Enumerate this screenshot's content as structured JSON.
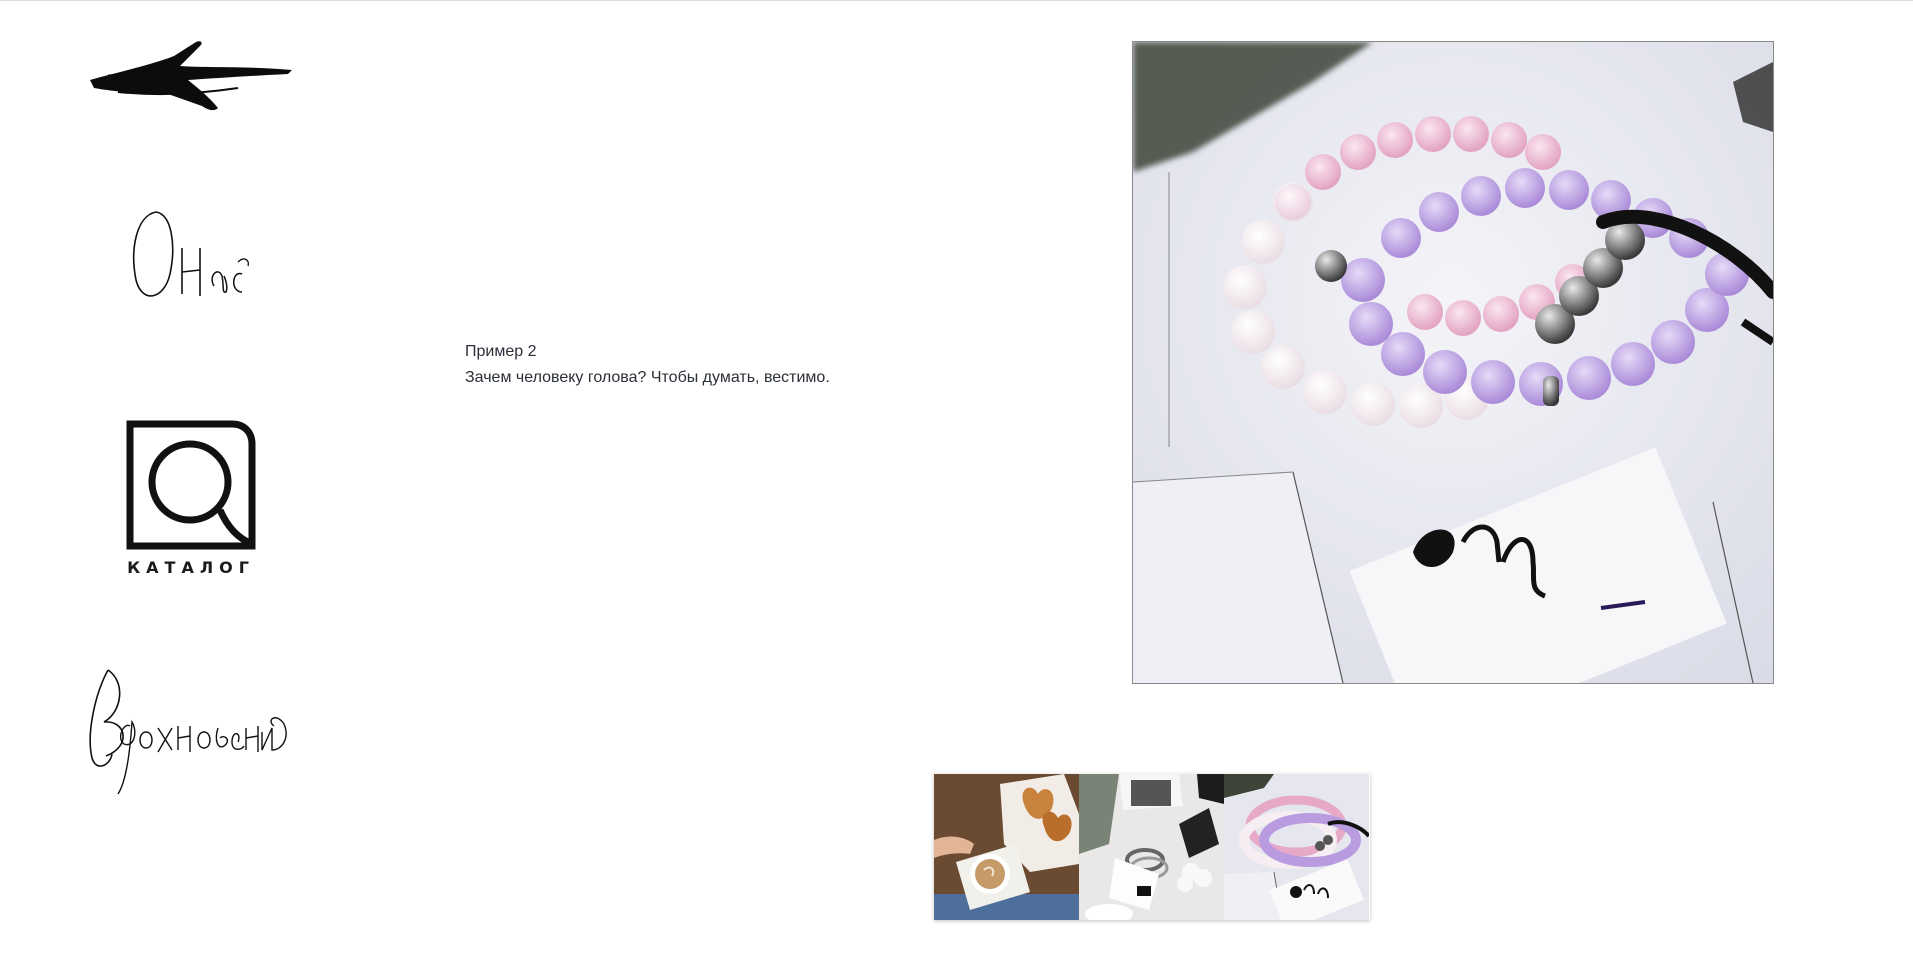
{
  "nav": {
    "back": {
      "icon": "brush-arrow-left-icon"
    },
    "about": {
      "label": "О нас"
    },
    "catalog": {
      "label": "КАТАЛОГ",
      "icon": "catalog-logo-icon"
    },
    "inspiration": {
      "label": "Вдохновение"
    }
  },
  "content": {
    "line1": "Пример 2",
    "line2": "Зачем человеку голова? Чтобы думать, вестимо."
  },
  "gallery": {
    "main_image": "bracelets-photo",
    "thumbnails": [
      {
        "name": "coffee-croissants-photo"
      },
      {
        "name": "flatlay-bracelets-photo"
      },
      {
        "name": "bracelets-tag-photo"
      }
    ]
  },
  "colors": {
    "text": "#2a2f38",
    "pink_bead": "#e8a9c6",
    "lilac_bead": "#b89ae0"
  }
}
